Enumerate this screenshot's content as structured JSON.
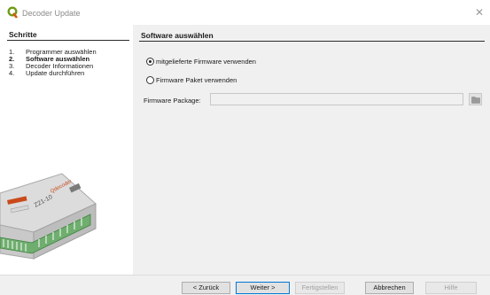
{
  "window": {
    "title": "Decoder Update"
  },
  "left": {
    "heading": "Schritte",
    "steps": [
      {
        "num": "1.",
        "label": "Programmer auswählen"
      },
      {
        "num": "2.",
        "label": "Software auswählen"
      },
      {
        "num": "3.",
        "label": "Decoder Informationen"
      },
      {
        "num": "4.",
        "label": "Update durchführen"
      }
    ],
    "device_text": "Z21-10 Qdecoder"
  },
  "main": {
    "heading": "Software auswählen",
    "option_builtin": "mitgelieferte Firmware verwenden",
    "option_package": "Firmware Paket verwenden",
    "package_label": "Firmware Package:",
    "package_value": "",
    "selected_option": "builtin"
  },
  "footer": {
    "back": "< Zurück",
    "next": "Weiter >",
    "finish": "Fertigstellen",
    "cancel": "Abbrechen",
    "help": "Hilfe"
  }
}
